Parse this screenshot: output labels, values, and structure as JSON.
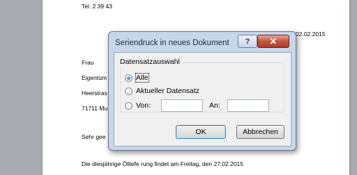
{
  "document": {
    "tel_line": "Tel. 2 39 43",
    "date_line": "02.02.2015",
    "salutation_frau": "Frau",
    "recipient_line1": "Eigentüm",
    "recipient_line2": "Heerstras",
    "recipient_line3": "71711 Mu",
    "greeting": "Sehr gee",
    "body_line": "Die diesjährige Ölliefe rung findet am Freitag, den 27.02.2015"
  },
  "dialog": {
    "title": "Seriendruck in neues Dokument",
    "help_label": "?",
    "close_label": "✕",
    "group_title": "Datensatzauswahl",
    "option_all": "Alle",
    "option_current": "Aktueller Datensatz",
    "option_from": "Von:",
    "to_label": "An:",
    "from_value": "",
    "to_value": "",
    "ok_label": "OK",
    "cancel_label": "Abbrechen"
  }
}
